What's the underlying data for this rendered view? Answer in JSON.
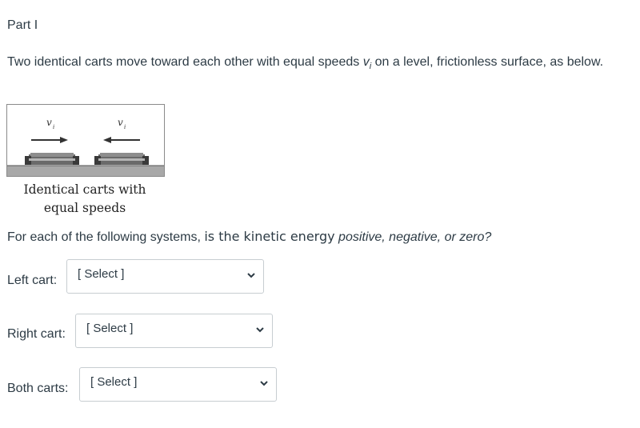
{
  "part_title": "Part I",
  "intro": {
    "text_before": "Two identical carts move toward each other with equal speeds ",
    "v_symbol": "v",
    "v_subscript": "i",
    "text_after": " on a level, frictionless surface, as below."
  },
  "figure": {
    "left_label": "v",
    "left_sub": "i",
    "right_label": "v",
    "right_sub": "i",
    "caption_line1": "Identical carts with",
    "caption_line2": "equal speeds"
  },
  "question": {
    "part1": "For each of the following systems, ",
    "part2": "is the kinetic energy",
    "part3": " positive, negative,",
    "part4": " or ",
    "part5": "zero?"
  },
  "selects": [
    {
      "label": "Left cart:",
      "value": "[ Select ]"
    },
    {
      "label": "Right cart:",
      "value": "[ Select ]"
    },
    {
      "label": "Both carts:",
      "value": "[ Select ]"
    }
  ]
}
